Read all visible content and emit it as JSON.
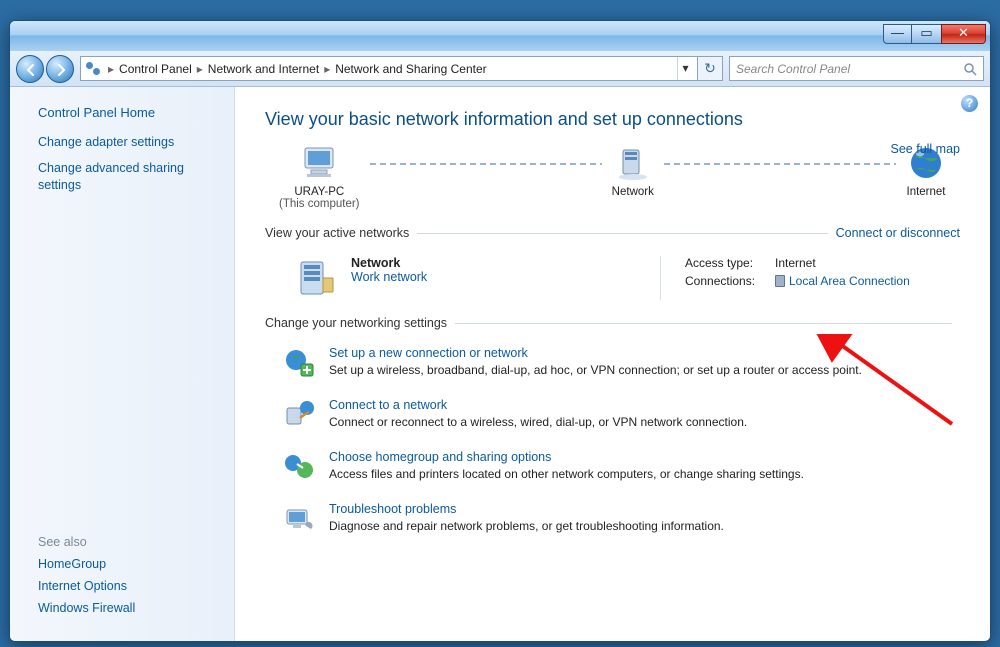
{
  "window": {
    "minimize_glyph": "—",
    "maximize_glyph": "▭",
    "close_glyph": "✕"
  },
  "breadcrumb": {
    "items": [
      "Control Panel",
      "Network and Internet",
      "Network and Sharing Center"
    ],
    "drop_glyph": "▾",
    "refresh_glyph": "↻"
  },
  "search": {
    "placeholder": "Search Control Panel"
  },
  "sidebar": {
    "home": "Control Panel Home",
    "tasks": [
      "Change adapter settings",
      "Change advanced sharing settings"
    ],
    "see_also_header": "See also",
    "see_also": [
      "HomeGroup",
      "Internet Options",
      "Windows Firewall"
    ]
  },
  "page": {
    "title": "View your basic network information and set up connections",
    "see_full_map": "See full map",
    "nodes": {
      "pc_name": "URAY-PC",
      "pc_sub": "(This computer)",
      "mid": "Network",
      "internet": "Internet"
    },
    "active_header": "View your active networks",
    "connect_disconnect": "Connect or disconnect",
    "network_name": "Network",
    "network_type": "Work network",
    "access_k": "Access type:",
    "access_v": "Internet",
    "conn_k": "Connections:",
    "conn_v": "Local Area Connection",
    "settings_header": "Change your networking settings",
    "settings": [
      {
        "title": "Set up a new connection or network",
        "desc": "Set up a wireless, broadband, dial-up, ad hoc, or VPN connection; or set up a router or access point."
      },
      {
        "title": "Connect to a network",
        "desc": "Connect or reconnect to a wireless, wired, dial-up, or VPN network connection."
      },
      {
        "title": "Choose homegroup and sharing options",
        "desc": "Access files and printers located on other network computers, or change sharing settings."
      },
      {
        "title": "Troubleshoot problems",
        "desc": "Diagnose and repair network problems, or get troubleshooting information."
      }
    ],
    "help_glyph": "?"
  }
}
